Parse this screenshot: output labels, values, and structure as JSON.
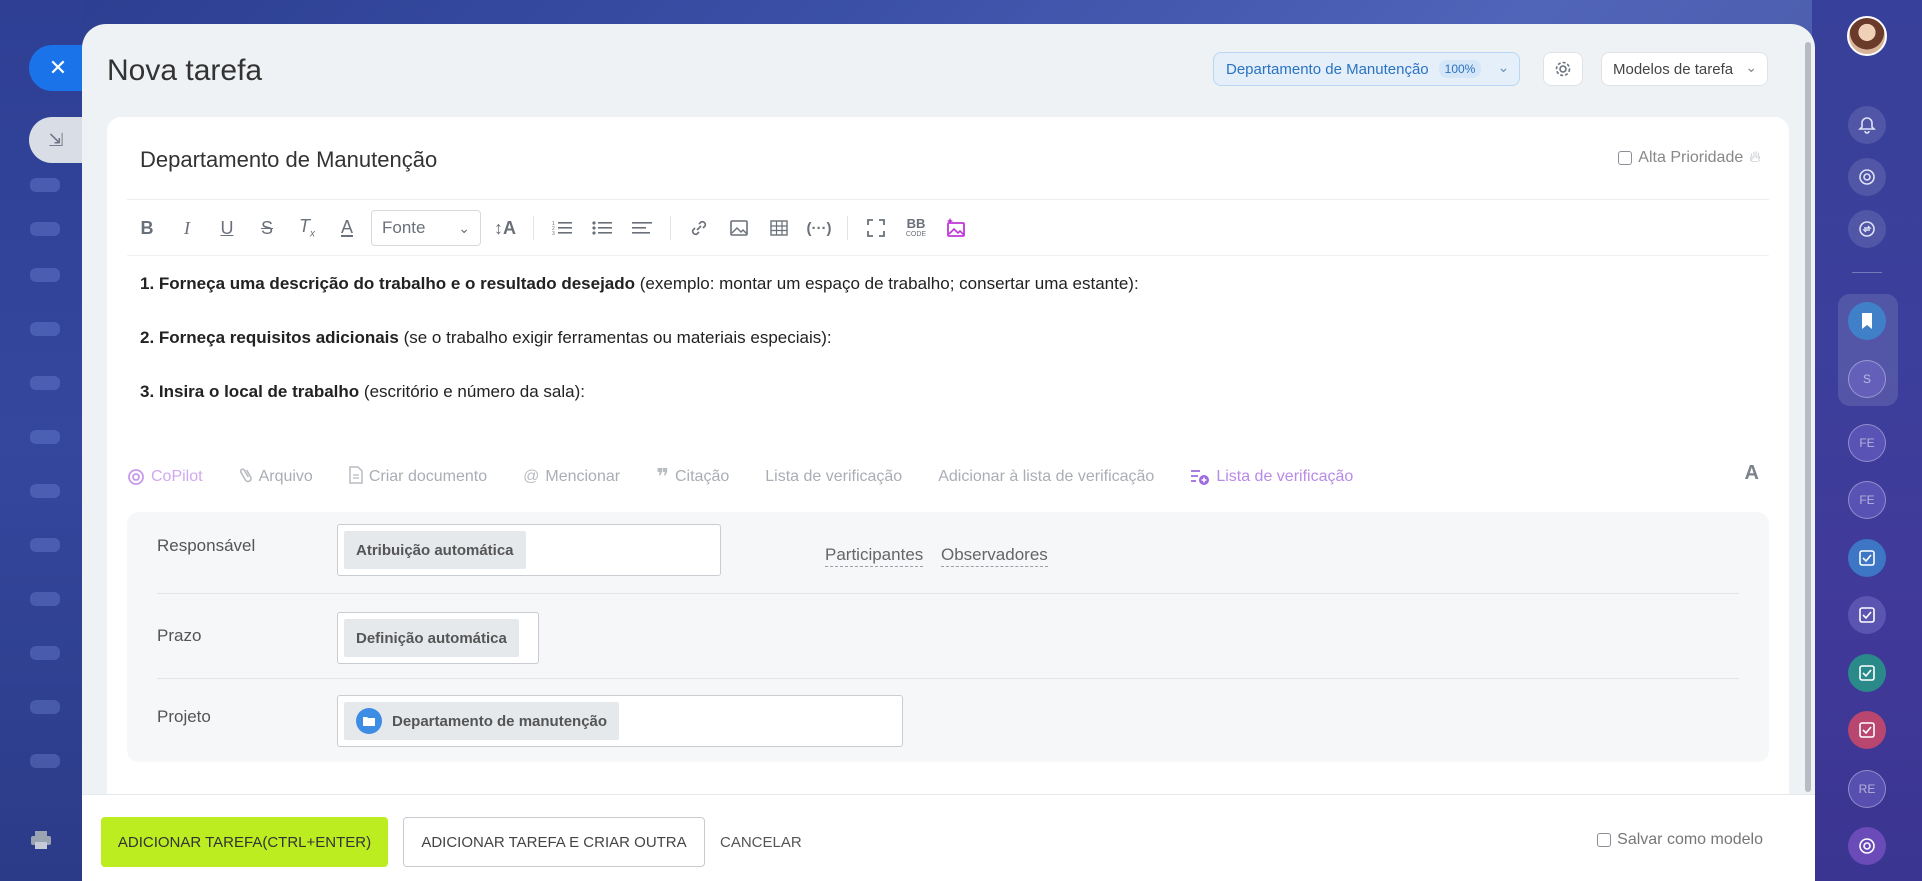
{
  "window": {
    "title": "Nova tarefa"
  },
  "header": {
    "department": "Departamento de Manutenção",
    "department_percent": "100%",
    "templates_label": "Modelos de tarefa"
  },
  "task": {
    "title": "Departamento de Manutenção",
    "high_priority_label": "Alta Prioridade"
  },
  "toolbar": {
    "font_label": "Fonte",
    "buttons": [
      "bold",
      "italic",
      "underline",
      "strikethrough",
      "clear-format",
      "text-color",
      "font-size",
      "numbered-list",
      "bulleted-list",
      "align",
      "link",
      "image",
      "table",
      "code",
      "fullscreen",
      "bbcode",
      "ai-image"
    ],
    "bb_label": "BB",
    "bb_sublabel": "CODE"
  },
  "description": {
    "line1_bold": "1. Forneça uma descrição do trabalho e o resultado desejado",
    "line1_rest": " (exemplo: montar um espaço de trabalho; consertar uma estante):",
    "line2_bold": "2. Forneça requisitos adicionais",
    "line2_rest": " (se o trabalho exigir ferramentas ou materiais especiais):",
    "line3_bold": "3. Insira o local de trabalho",
    "line3_rest": " (escritório e número da sala):"
  },
  "actions": {
    "copilot": "CoPilot",
    "file": "Arquivo",
    "create_doc": "Criar documento",
    "mention": "Mencionar",
    "quote": "Citação",
    "checklist": "Lista de verificação",
    "add_to_checklist": "Adicionar à lista de verificação",
    "checklist_new": "Lista de verificação",
    "format_a": "A"
  },
  "fields": {
    "responsible_label": "Responsável",
    "responsible_value": "Atribuição automática",
    "participants": "Participantes",
    "observers": "Observadores",
    "deadline_label": "Prazo",
    "deadline_value": "Definição automática",
    "project_label": "Projeto",
    "project_value": "Departamento de manutenção"
  },
  "footer": {
    "add_task": "ADICIONAR TAREFA(CTRL+ENTER)",
    "add_and_create": "ADICIONAR TAREFA E CRIAR OUTRA",
    "cancel": "CANCELAR",
    "save_template": "Salvar como modelo"
  },
  "right_sidebar": {
    "letters": [
      "S",
      "FE",
      "FE",
      "RE"
    ]
  },
  "colors": {
    "accent_blue": "#1a73e8",
    "primary_button": "#bbed21",
    "copilot_purple": "#c79ae9"
  }
}
